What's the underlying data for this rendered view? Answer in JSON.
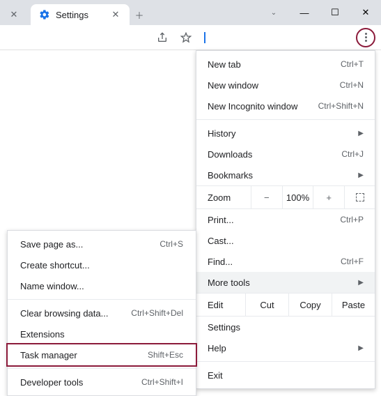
{
  "tabs": {
    "active_label": "Settings"
  },
  "menu": {
    "new_tab": "New tab",
    "new_tab_sc": "Ctrl+T",
    "new_window": "New window",
    "new_window_sc": "Ctrl+N",
    "incognito": "New Incognito window",
    "incognito_sc": "Ctrl+Shift+N",
    "history": "History",
    "downloads": "Downloads",
    "downloads_sc": "Ctrl+J",
    "bookmarks": "Bookmarks",
    "zoom_label": "Zoom",
    "zoom_val": "100%",
    "print": "Print...",
    "print_sc": "Ctrl+P",
    "cast": "Cast...",
    "find": "Find...",
    "find_sc": "Ctrl+F",
    "more_tools": "More tools",
    "edit_label": "Edit",
    "cut": "Cut",
    "copy": "Copy",
    "paste": "Paste",
    "settings": "Settings",
    "help": "Help",
    "exit": "Exit"
  },
  "submenu": {
    "save_page": "Save page as...",
    "save_page_sc": "Ctrl+S",
    "create_shortcut": "Create shortcut...",
    "name_window": "Name window...",
    "clear_data": "Clear browsing data...",
    "clear_data_sc": "Ctrl+Shift+Del",
    "extensions": "Extensions",
    "task_manager": "Task manager",
    "task_manager_sc": "Shift+Esc",
    "dev_tools": "Developer tools",
    "dev_tools_sc": "Ctrl+Shift+I"
  }
}
